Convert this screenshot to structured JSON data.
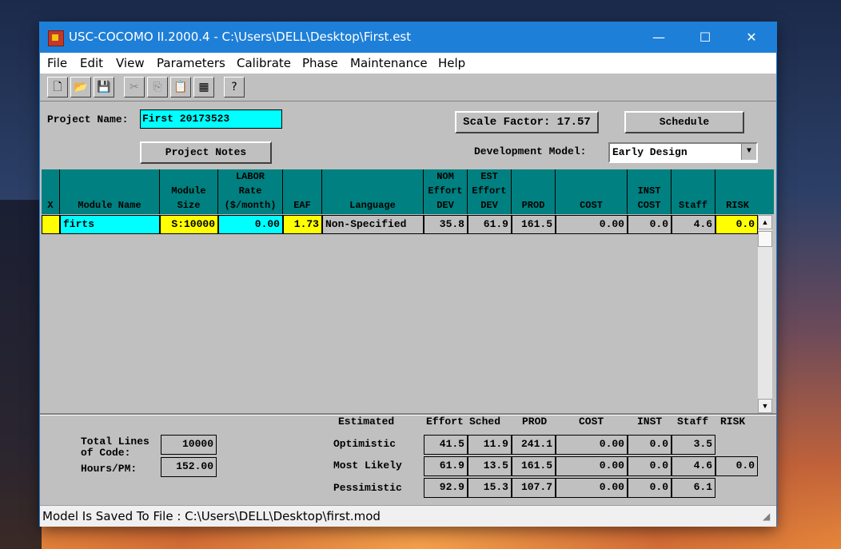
{
  "window": {
    "title": "USC-COCOMO II.2000.4 - C:\\Users\\DELL\\Desktop\\First.est",
    "min": "—",
    "max": "☐",
    "close": "✕"
  },
  "menu": [
    "File",
    "Edit",
    "View",
    "Parameters",
    "Calibrate",
    "Phase",
    "Maintenance",
    "Help"
  ],
  "toolbar": {
    "new": "🗋",
    "open": "📂",
    "save": "💾",
    "cut": "✂",
    "copy": "⎘",
    "paste": "📋",
    "estimate": "▦",
    "help": "?"
  },
  "project": {
    "name_label": "Project Name:",
    "name_value": "First 20173523",
    "notes_button": "Project Notes",
    "scale_factor_button": "Scale Factor: 17.57",
    "schedule_button": "Schedule",
    "dev_model_label": "Development Model:",
    "dev_model_value": "Early Design"
  },
  "table": {
    "headers": {
      "x": "X",
      "module_name": "Module Name",
      "module_size_1": "Module",
      "module_size_2": "Size",
      "labor_1": "LABOR",
      "labor_2": "Rate",
      "labor_3": "($/month)",
      "eaf": "EAF",
      "language": "Language",
      "nom_1": "NOM",
      "nom_2": "Effort",
      "nom_3": "DEV",
      "est_1": "EST",
      "est_2": "Effort",
      "est_3": "DEV",
      "prod": "PROD",
      "cost": "COST",
      "inst_1": "INST",
      "inst_2": "COST",
      "staff": "Staff",
      "risk": "RISK"
    },
    "row": {
      "x": "",
      "module_name": "firts",
      "module_size": "S:10000",
      "labor_rate": "0.00",
      "eaf": "1.73",
      "language": "Non-Specified",
      "nom_effort": "35.8",
      "est_effort": "61.9",
      "prod": "161.5",
      "cost": "0.00",
      "inst_cost": "0.0",
      "staff": "4.6",
      "risk": "0.0"
    }
  },
  "summary": {
    "total_lines_label_1": "Total Lines",
    "total_lines_label_2": "of Code:",
    "total_lines_value": "10000",
    "hours_label": "Hours/PM:",
    "hours_value": "152.00",
    "col_estimated": "Estimated",
    "col_effort": "Effort",
    "col_sched": "Sched",
    "col_prod": "PROD",
    "col_cost": "COST",
    "col_inst": "INST",
    "col_staff": "Staff",
    "col_risk": "RISK",
    "optimistic": {
      "label": "Optimistic",
      "effort": "41.5",
      "sched": "11.9",
      "prod": "241.1",
      "cost": "0.00",
      "inst": "0.0",
      "staff": "3.5"
    },
    "most_likely": {
      "label": "Most Likely",
      "effort": "61.9",
      "sched": "13.5",
      "prod": "161.5",
      "cost": "0.00",
      "inst": "0.0",
      "staff": "4.6",
      "risk": "0.0"
    },
    "pessimistic": {
      "label": "Pessimistic",
      "effort": "92.9",
      "sched": "15.3",
      "prod": "107.7",
      "cost": "0.00",
      "inst": "0.0",
      "staff": "6.1"
    }
  },
  "status": "Model Is Saved To File : C:\\Users\\DELL\\Desktop\\first.mod"
}
